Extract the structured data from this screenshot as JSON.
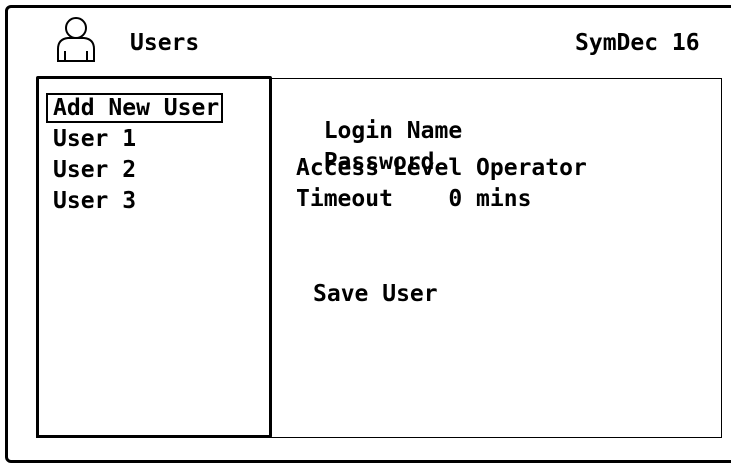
{
  "header": {
    "icon": "user-icon",
    "title": "Users",
    "device_name": "SymDec 16"
  },
  "user_list": {
    "items": [
      {
        "label": "Add New User",
        "selected": true
      },
      {
        "label": "User 1",
        "selected": false
      },
      {
        "label": "User 2",
        "selected": false
      },
      {
        "label": "User 3",
        "selected": false
      }
    ]
  },
  "details": {
    "login_name_label": "Login Name",
    "password_label": "Password",
    "access_level_label": "Access Level",
    "access_level_value": "Operator",
    "timeout_label": "Timeout",
    "timeout_value": "0",
    "timeout_unit": "mins"
  },
  "actions": {
    "save_label": "Save User"
  },
  "colors": {
    "foreground": "#000000",
    "background": "#ffffff"
  }
}
